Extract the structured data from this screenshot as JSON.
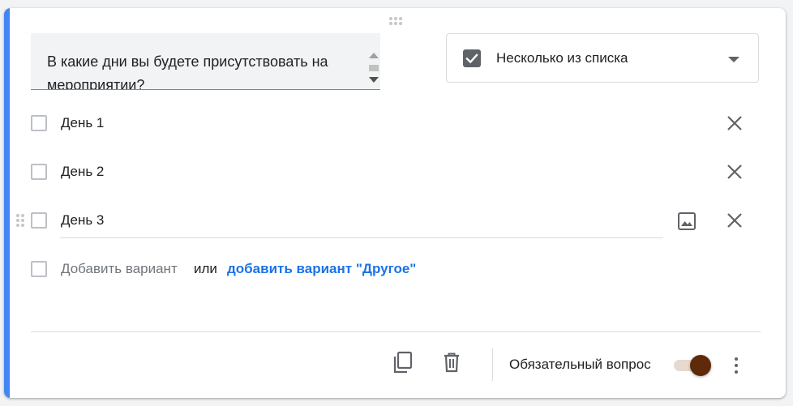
{
  "question": {
    "title": "В какие дни вы будете присутствовать на мероприятии?"
  },
  "question_type": {
    "selected": "Несколько из списка",
    "icon": "checkbox-checked-icon"
  },
  "options": [
    {
      "label": "День 1"
    },
    {
      "label": "День 2"
    },
    {
      "label": "День 3"
    }
  ],
  "add_option": {
    "label": "Добавить вариант",
    "or": "или",
    "other_link": "добавить вариант \"Другое\""
  },
  "footer": {
    "required_label": "Обязательный вопрос",
    "required_on": true
  },
  "colors": {
    "accent": "#4285f4",
    "link": "#1a73e8",
    "toggle_knob": "#5e2a0a",
    "toggle_track": "#e6d9d0"
  },
  "icons": {
    "drag": "drag-handle-icon",
    "remove": "close-icon",
    "image": "image-icon",
    "duplicate": "copy-icon",
    "delete": "trash-icon",
    "more": "more-vertical-icon"
  }
}
